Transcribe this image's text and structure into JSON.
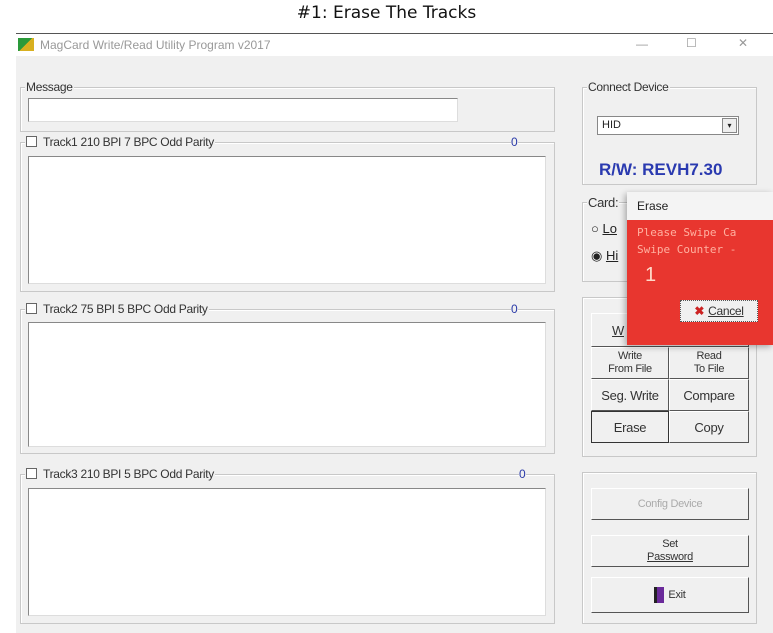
{
  "caption": "#1: Erase The Tracks",
  "window": {
    "title": "MagCard Write/Read Utility Program  v2017",
    "minimize": "—",
    "maximize": "☐",
    "close": "✕"
  },
  "message": {
    "label": "Message",
    "value": ""
  },
  "tracks": [
    {
      "label": "Track1   210 BPI  7 BPC  Odd Parity",
      "count": "0",
      "value": ""
    },
    {
      "label": "Track2   75 BPI  5 BPC  Odd Parity",
      "count": "0",
      "value": ""
    },
    {
      "label": "Track3   210 BPI  5 BPC  Odd Parity",
      "count": "0",
      "value": ""
    }
  ],
  "connect": {
    "label": "Connect Device",
    "selected": "HID",
    "version": "R/W: REVH7.30"
  },
  "card": {
    "label": "Card:",
    "options": [
      {
        "label": "Lo",
        "checked": false
      },
      {
        "label": "Hi",
        "checked": true
      }
    ]
  },
  "buttons": {
    "write": "W",
    "write_from_file": [
      "Write",
      "From File"
    ],
    "read_to_file": [
      "Read",
      "To File"
    ],
    "seg_write": "Seg. Write",
    "compare": "Compare",
    "erase": "Erase",
    "copy": "Copy",
    "config": "Config Device",
    "set_password": [
      "Set",
      "Password"
    ],
    "exit": "Exit"
  },
  "dialog": {
    "title": "Erase",
    "line1": "Please Swipe Ca",
    "line2": "Swipe Counter -",
    "counter": "1",
    "cancel": "Cancel",
    "color": "#e8362f"
  }
}
